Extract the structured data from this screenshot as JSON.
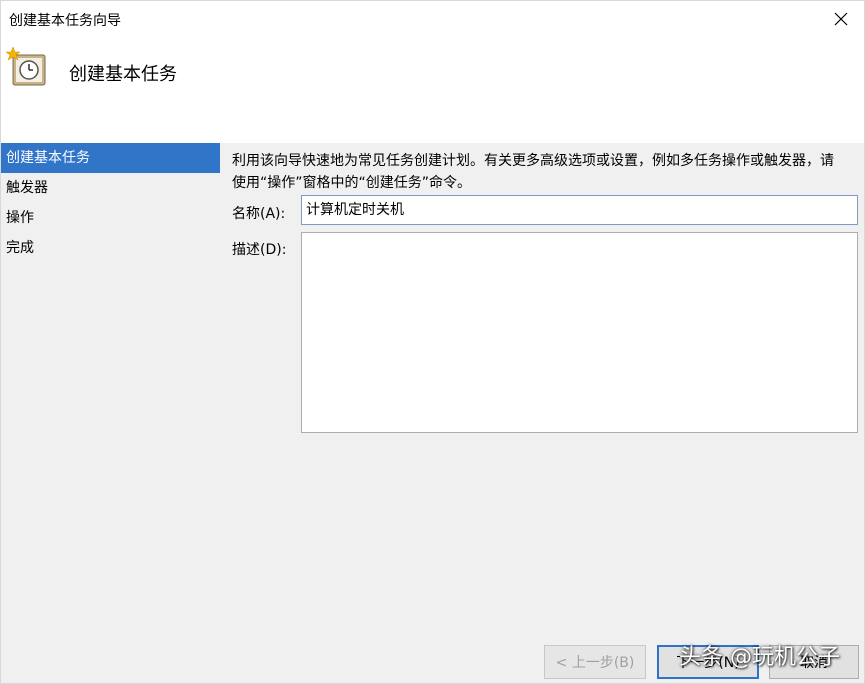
{
  "window": {
    "title": "创建基本任务向导"
  },
  "header": {
    "title": "创建基本任务",
    "icon": "task-clock-icon"
  },
  "sidebar": {
    "items": [
      {
        "label": "创建基本任务",
        "selected": true
      },
      {
        "label": "触发器",
        "selected": false
      },
      {
        "label": "操作",
        "selected": false
      },
      {
        "label": "完成",
        "selected": false
      }
    ]
  },
  "main": {
    "intro": "利用该向导快速地为常见任务创建计划。有关更多高级选项或设置，例如多任务操作或触发器，请使用“操作”窗格中的“创建任务”命令。",
    "name_label": "名称(A):",
    "name_value": "计算机定时关机",
    "description_label": "描述(D):",
    "description_value": ""
  },
  "buttons": {
    "back": "< 上一步(B)",
    "next": "下一步(N)",
    "cancel": "取消"
  },
  "watermark": "头条 @玩机公子",
  "colors": {
    "selected_bg": "#3175c9",
    "panel_bg": "#f0f0f0",
    "input_border": "#7a9bc9"
  }
}
